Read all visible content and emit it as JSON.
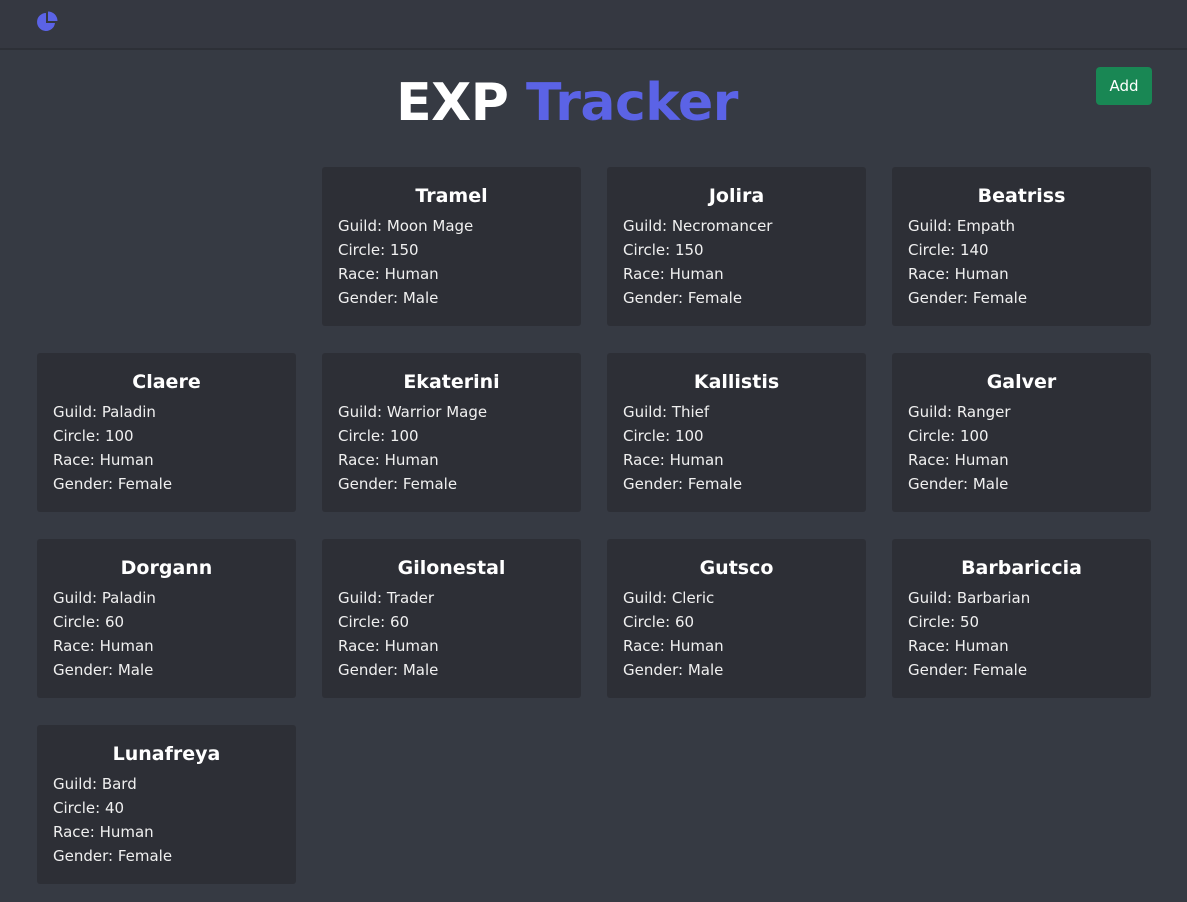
{
  "nav": {
    "logo_icon": "pie-chart-icon",
    "accent": "#5b63e6"
  },
  "header": {
    "title_part1": "EXP",
    "title_part2": "Tracker",
    "add_label": "Add",
    "add_color": "#198754"
  },
  "labels": {
    "guild": "Guild: ",
    "circle": "Circle: ",
    "race": "Race: ",
    "gender": "Gender: "
  },
  "characters": [
    {
      "name": "Tramel",
      "guild": "Moon Mage",
      "circle": "150",
      "race": "Human",
      "gender": "Male"
    },
    {
      "name": "Jolira",
      "guild": "Necromancer",
      "circle": "150",
      "race": "Human",
      "gender": "Female"
    },
    {
      "name": "Beatriss",
      "guild": "Empath",
      "circle": "140",
      "race": "Human",
      "gender": "Female"
    },
    {
      "name": "Claere",
      "guild": "Paladin",
      "circle": "100",
      "race": "Human",
      "gender": "Female"
    },
    {
      "name": "Ekaterini",
      "guild": "Warrior Mage",
      "circle": "100",
      "race": "Human",
      "gender": "Female"
    },
    {
      "name": "Kallistis",
      "guild": "Thief",
      "circle": "100",
      "race": "Human",
      "gender": "Female"
    },
    {
      "name": "Galver",
      "guild": "Ranger",
      "circle": "100",
      "race": "Human",
      "gender": "Male"
    },
    {
      "name": "Dorgann",
      "guild": "Paladin",
      "circle": "60",
      "race": "Human",
      "gender": "Male"
    },
    {
      "name": "Gilonestal",
      "guild": "Trader",
      "circle": "60",
      "race": "Human",
      "gender": "Male"
    },
    {
      "name": "Gutsco",
      "guild": "Cleric",
      "circle": "60",
      "race": "Human",
      "gender": "Male"
    },
    {
      "name": "Barbariccia",
      "guild": "Barbarian",
      "circle": "50",
      "race": "Human",
      "gender": "Female"
    },
    {
      "name": "Lunafreya",
      "guild": "Bard",
      "circle": "40",
      "race": "Human",
      "gender": "Female"
    }
  ]
}
